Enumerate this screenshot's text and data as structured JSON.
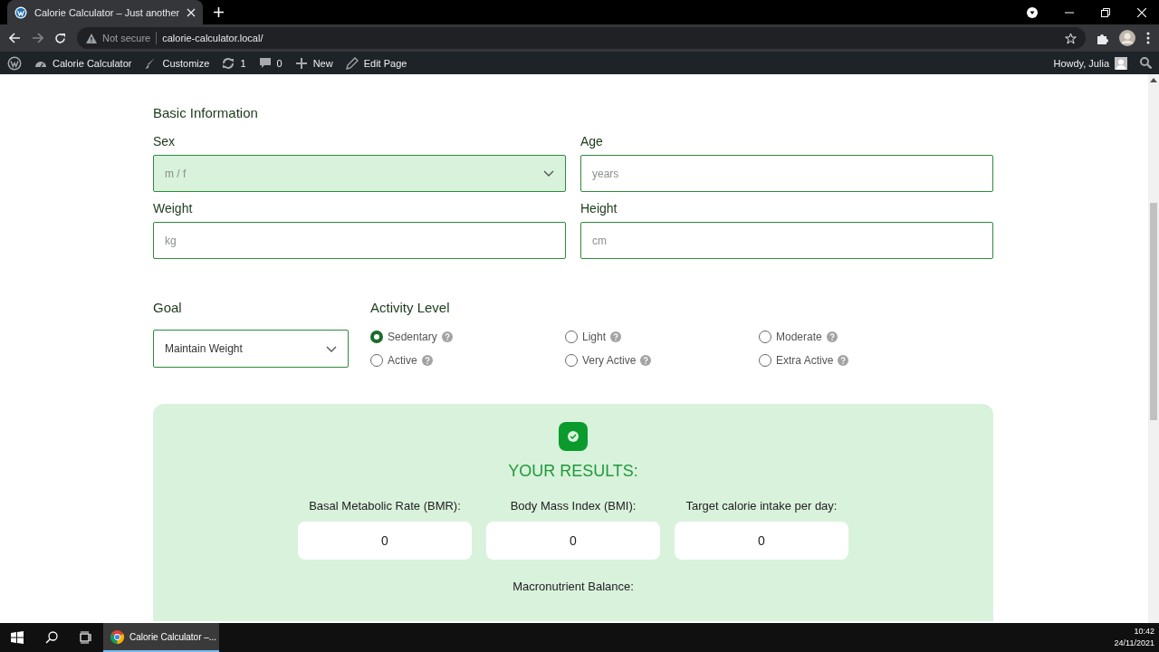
{
  "browser": {
    "tab_title": "Calorie Calculator – Just another",
    "security": "Not secure",
    "url": "calorie-calculator.local/"
  },
  "admin_bar": {
    "items": [
      {
        "kind": "site",
        "label": "Calorie Calculator"
      },
      {
        "kind": "customize",
        "label": "Customize"
      },
      {
        "kind": "updates",
        "label": "1"
      },
      {
        "kind": "comments",
        "label": "0"
      },
      {
        "kind": "new",
        "label": "New"
      },
      {
        "kind": "edit",
        "label": "Edit Page"
      }
    ],
    "greeting": "Howdy, Julia"
  },
  "form": {
    "section_title": "Basic Information",
    "fields": [
      {
        "label": "Sex",
        "kind": "select",
        "placeholder": "m / f",
        "hovered": true
      },
      {
        "label": "Age",
        "kind": "input",
        "placeholder": "years",
        "hovered": false
      },
      {
        "label": "Weight",
        "kind": "input",
        "placeholder": "kg",
        "hovered": false
      },
      {
        "label": "Height",
        "kind": "input",
        "placeholder": "cm",
        "hovered": false
      }
    ],
    "goal": {
      "label": "Goal",
      "value": "Maintain Weight"
    },
    "activity": {
      "title": "Activity Level",
      "options": [
        {
          "label": "Sedentary",
          "selected": true
        },
        {
          "label": "Light",
          "selected": false
        },
        {
          "label": "Moderate",
          "selected": false
        },
        {
          "label": "Active",
          "selected": false
        },
        {
          "label": "Very Active",
          "selected": false
        },
        {
          "label": "Extra Active",
          "selected": false
        }
      ]
    }
  },
  "results": {
    "title": "YOUR RESULTS:",
    "metrics": [
      {
        "label": "Basal Metabolic Rate (BMR):",
        "value": "0"
      },
      {
        "label": "Body Mass Index (BMI):",
        "value": "0"
      },
      {
        "label": "Target calorie intake per day:",
        "value": "0"
      }
    ],
    "macronutrient_label": "Macronutrient Balance:"
  },
  "taskbar": {
    "app": "Calorie Calculator –...",
    "time": "10:42",
    "date": "24/11/2021"
  }
}
